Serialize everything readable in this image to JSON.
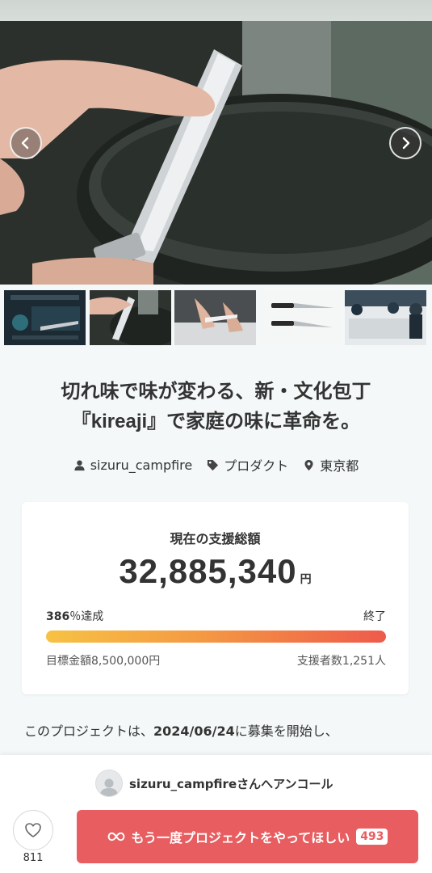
{
  "project": {
    "title_line1": "切れ味で味が変わる、新・文化包丁",
    "title_line2": "『kireaji』で家庭の味に革命を。",
    "owner": "sizuru_campfire",
    "category": "プロダクト",
    "location": "東京都"
  },
  "funding": {
    "label": "現在の支援総額",
    "amount": "32,885,340",
    "currency": "円",
    "percent": "386",
    "percent_suffix": "％達成",
    "status": "終了",
    "goal": "目標金額8,500,000円",
    "backers": "支援者数1,251人",
    "progress_fraction": 1.0
  },
  "description": {
    "prefix": "このプロジェクトは、",
    "date": "2024/06/24",
    "suffix": "に募集を開始し、"
  },
  "encore": {
    "text": "sizuru_campfireさんへアンコール"
  },
  "actions": {
    "favorite_count": "811",
    "cta_label": "もう一度プロジェクトをやってほしい",
    "cta_count": "493"
  },
  "icons": {
    "prev": "chevron-left-icon",
    "next": "chevron-right-icon",
    "owner": "user-icon",
    "category": "tag-icon",
    "location": "map-pin-icon",
    "favorite": "heart-icon",
    "cta": "infinity-icon"
  },
  "colors": {
    "cta": "#e85d60",
    "bar_start": "#f7c244",
    "bar_end": "#ee5a4b"
  }
}
